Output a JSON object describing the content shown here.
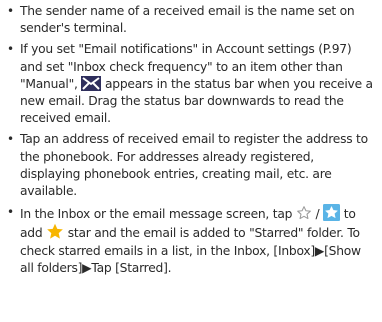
{
  "notes": {
    "item1": {
      "text": "The sender name of a received email is the name set on sender's terminal."
    },
    "item2": {
      "part1": "If you set \"Email notifications\" in Account settings (P.97) and set \"Inbox check frequency\" to an item other than \"Manual\",",
      "icon": "new-email-envelope-icon",
      "part2": "appears in the status bar when you receive a new email. Drag the status bar downwards to read the received email."
    },
    "item3": {
      "text": "Tap an address of received email to register the address to the phonebook. For addresses already registered, displaying phonebook entries, creating mail, etc. are available."
    },
    "item4": {
      "part1": "In the Inbox or the email message screen, tap",
      "icon_outline": "star-outline-icon",
      "sep": "/",
      "icon_filled": "star-filled-button-icon",
      "part2": "to add",
      "icon_star": "yellow-star-icon",
      "part3": "star and the email is added to \"Starred\" folder. To check starred emails in a list, in the Inbox, [Inbox]▶[Show all folders]▶Tap [Starred]."
    }
  },
  "colors": {
    "text": "#2a2a2a",
    "envelope_bg": "#2e2e5c",
    "star_button_bg": "#5ab4e6",
    "star_yellow": "#f7b500",
    "star_outline": "#9a9a9a"
  }
}
